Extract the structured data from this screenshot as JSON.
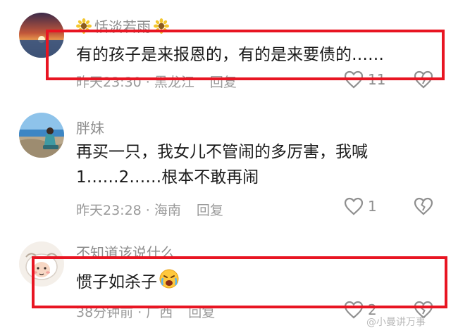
{
  "comments": [
    {
      "username": "恬淡若雨",
      "text_lines": [
        "有的孩子是来报恩的，有的是来要债的……"
      ],
      "time": "昨天23:30",
      "location": "黑龙江",
      "reply_label": "回复",
      "like_count": "11",
      "avatar_icon": "sunset-avatar",
      "username_decoration_icon": "sunflower-icon"
    },
    {
      "username": "胖妹",
      "text_lines": [
        "再买一只，我女儿不管闹的多厉害，我喊",
        "1……2……根本不敢再闹"
      ],
      "time": "昨天23:28",
      "location": "海南",
      "reply_label": "回复",
      "like_count": "1",
      "avatar_icon": "beach-avatar"
    },
    {
      "username": "不知道该说什么",
      "text_lines": [
        "惯子如杀子"
      ],
      "time": "38分钟前",
      "location": "广西",
      "reply_label": "回复",
      "like_count": "2",
      "avatar_icon": "cartoon-sheep-avatar",
      "text_emoji_icon": "crying-face-emoji"
    }
  ],
  "watermark": "@小曼讲万事",
  "colors": {
    "highlight_box": "#e81522",
    "meta_text": "#9a9a9a",
    "username": "#8d8d8d",
    "body_text": "#1a1a1a"
  }
}
